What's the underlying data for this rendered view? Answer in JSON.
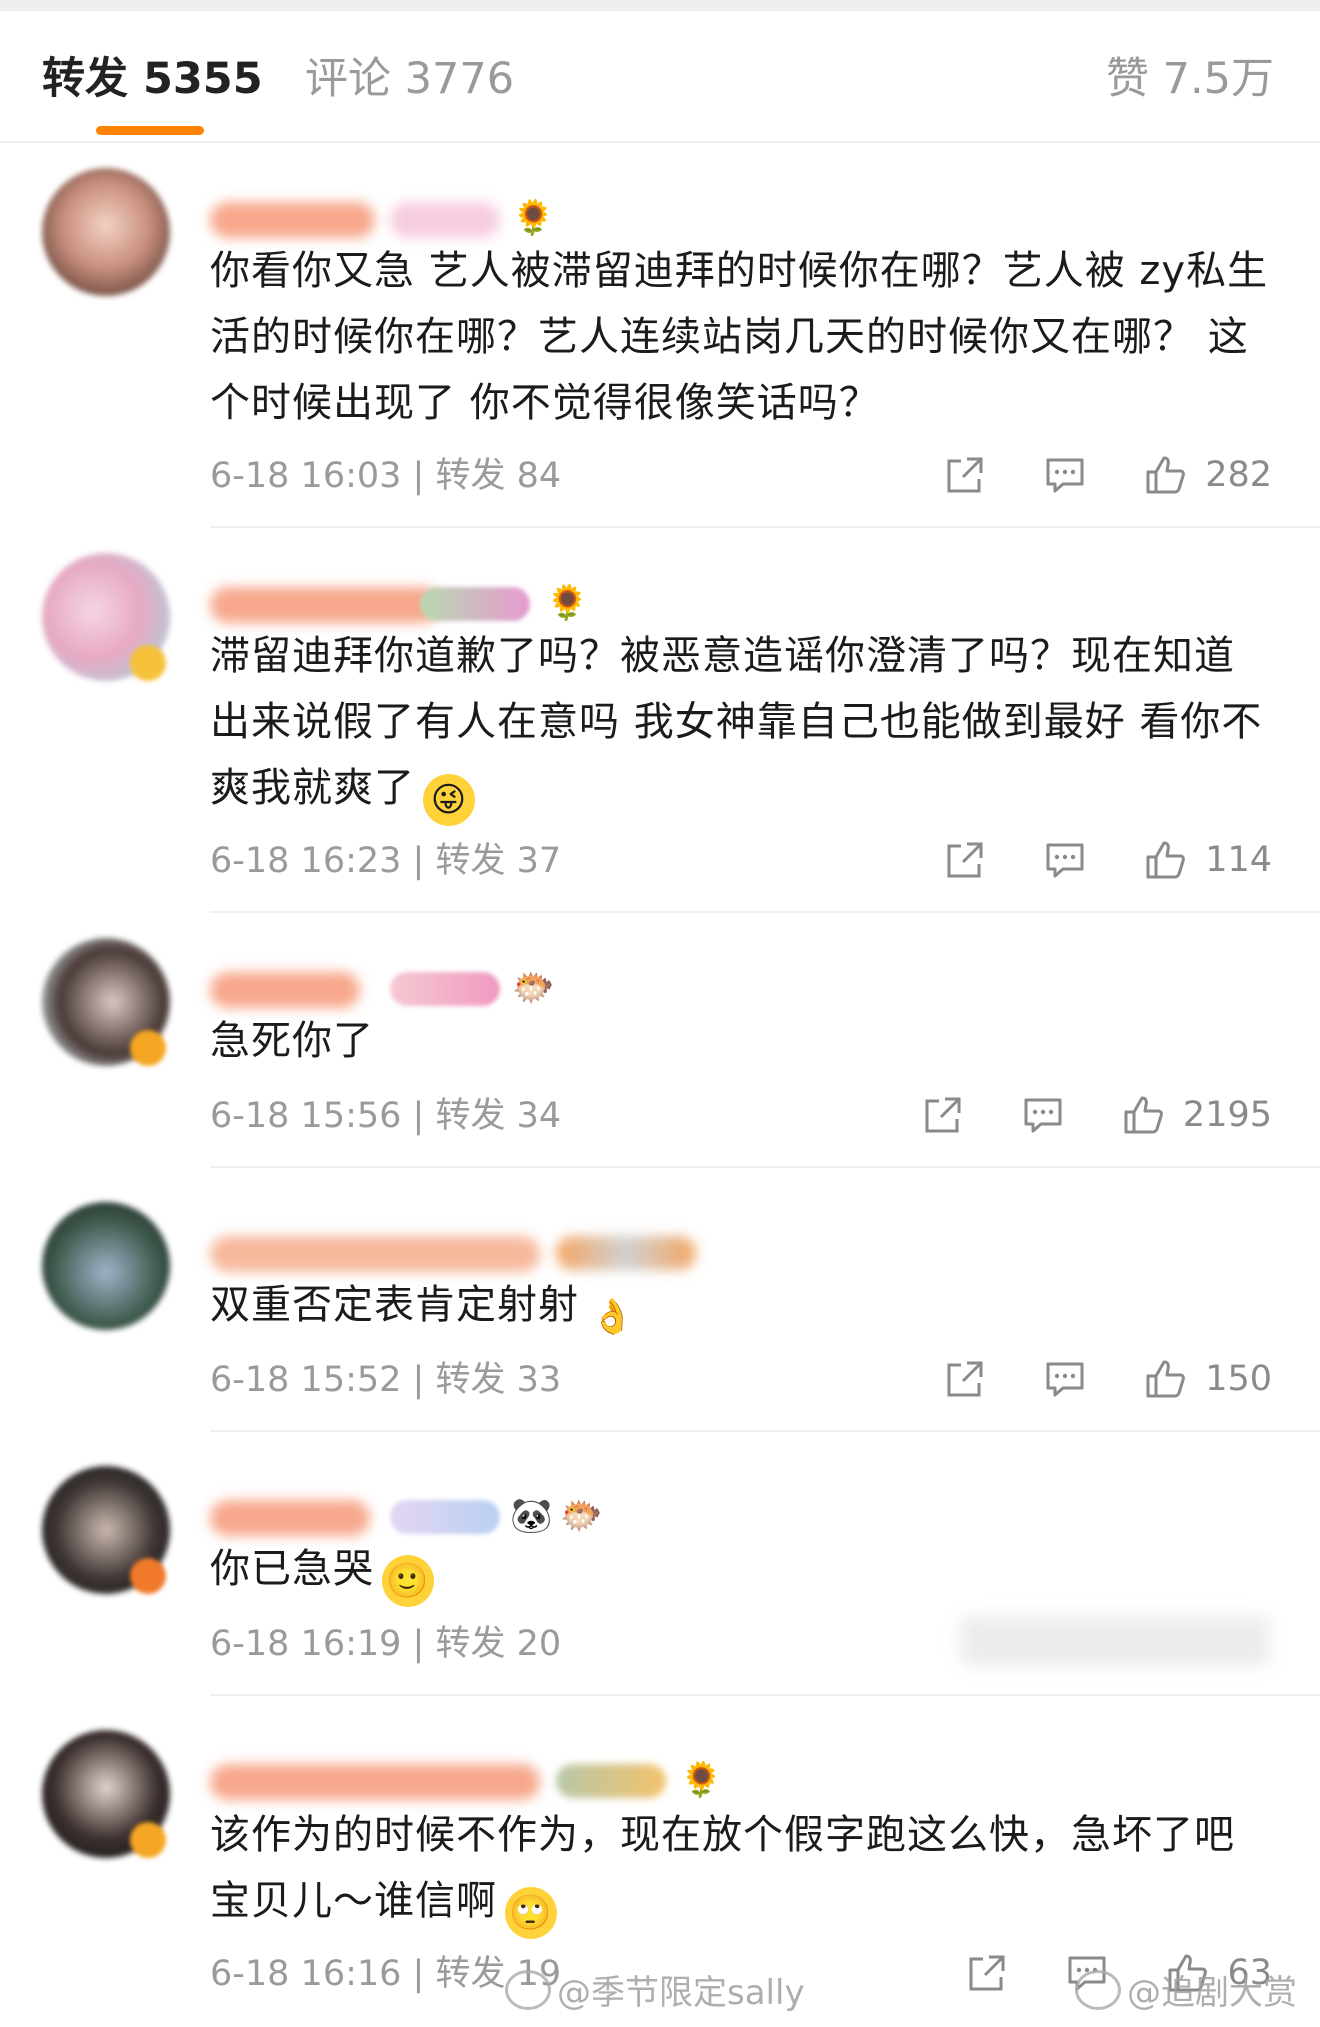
{
  "tabs": {
    "repost": "转发 5355",
    "comments": "评论 3776",
    "likes": "赞 7.5万"
  },
  "colors": {
    "accent": "#ff8200",
    "meta": "#9a9a9a",
    "divider": "#f0f0f0"
  },
  "comments": [
    {
      "text": "你看你又急 艺人被滞留迪拜的时候你在哪？艺人被 zy私生活的时候你在哪？艺人连续站岗几天的时候你又在哪？ 这个时候出现了 你不觉得很像笑话吗？",
      "meta": "6-18 16:03 | 转发 84",
      "likes": "282",
      "name_icons": [
        "sunflower-icon"
      ]
    },
    {
      "text": "滞留迪拜你道歉了吗？被恶意造谣你澄清了吗？现在知道出来说假了有人在意吗 我女神靠自己也能做到最好 看你不爽我就爽了",
      "meta": "6-18 16:23 | 转发 37",
      "likes": "114",
      "inline_emoji": "😜",
      "name_icons": [
        "sunflower-icon"
      ]
    },
    {
      "text": "急死你了",
      "meta": "6-18 15:56 | 转发 34",
      "likes": "2195",
      "name_icons": [
        "level-badge-icon",
        "fish-icon"
      ]
    },
    {
      "text": "双重否定表肯定射射",
      "meta": "6-18 15:52 | 转发 33",
      "likes": "150",
      "inline_emoji": "👌",
      "name_icons": [
        "badge-icon"
      ]
    },
    {
      "text": "你已急哭",
      "meta": "6-18 16:19 | 转发 20",
      "likes": "",
      "inline_emoji": "🙂",
      "name_icons": [
        "level-badge-icon",
        "panda-icon",
        "fish-icon"
      ]
    },
    {
      "text": "该作为的时候不作为，现在放个假字跑这么快，急坏了吧宝贝儿～谁信啊",
      "meta": "6-18 16:16 | 转发 19",
      "likes": "63",
      "inline_emoji": "🙄",
      "name_icons": [
        "sunflower-icon"
      ]
    }
  ],
  "watermarks": {
    "left": "@季节限定sally",
    "right": "@追剧大赏"
  }
}
